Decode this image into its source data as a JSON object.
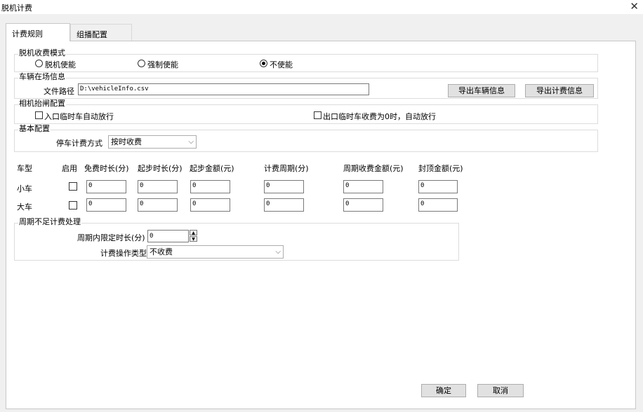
{
  "window": {
    "title": "脱机计费",
    "close_glyph": "✕"
  },
  "tabs": [
    {
      "label": "计费规则",
      "active": true
    },
    {
      "label": "组播配置",
      "active": false
    }
  ],
  "offline_mode": {
    "legend": "脱机收费模式",
    "options": [
      {
        "label": "脱机使能",
        "checked": false
      },
      {
        "label": "强制使能",
        "checked": false
      },
      {
        "label": "不使能",
        "checked": true
      }
    ]
  },
  "vehicle_info": {
    "legend": "车辆在场信息",
    "file_path_label": "文件路径",
    "file_path_value": "D:\\vehicleInfo.csv",
    "export_vehicle_button": "导出车辆信息",
    "export_billing_button": "导出计费信息"
  },
  "camera_gate": {
    "legend": "相机抬闸配置",
    "entry_checkbox": {
      "label": "入口临时车自动放行",
      "checked": false
    },
    "exit_checkbox": {
      "label": "出口临时车收费为0时，自动放行",
      "checked": false
    }
  },
  "basic": {
    "legend": "基本配置",
    "parking_mode_label": "停车计费方式",
    "parking_mode_value": "按时收费"
  },
  "fee_table": {
    "headers": [
      "车型",
      "启用",
      "免费时长(分)",
      "起步时长(分)",
      "起步金额(元)",
      "计费周期(分)",
      "周期收费金额(元)",
      "封顶金额(元)"
    ],
    "rows": [
      {
        "type": "小车",
        "enabled": false,
        "values": [
          "0",
          "0",
          "0",
          "0",
          "0",
          "0"
        ]
      },
      {
        "type": "大车",
        "enabled": false,
        "values": [
          "0",
          "0",
          "0",
          "0",
          "0",
          "0"
        ]
      }
    ]
  },
  "insufficient_period": {
    "legend": "周期不足计费处理",
    "limit_label": "周期内限定时长(分)",
    "limit_value": "0",
    "operation_label": "计费操作类型",
    "operation_value": "不收费"
  },
  "footer": {
    "ok_button": "确定",
    "cancel_button": "取消"
  }
}
